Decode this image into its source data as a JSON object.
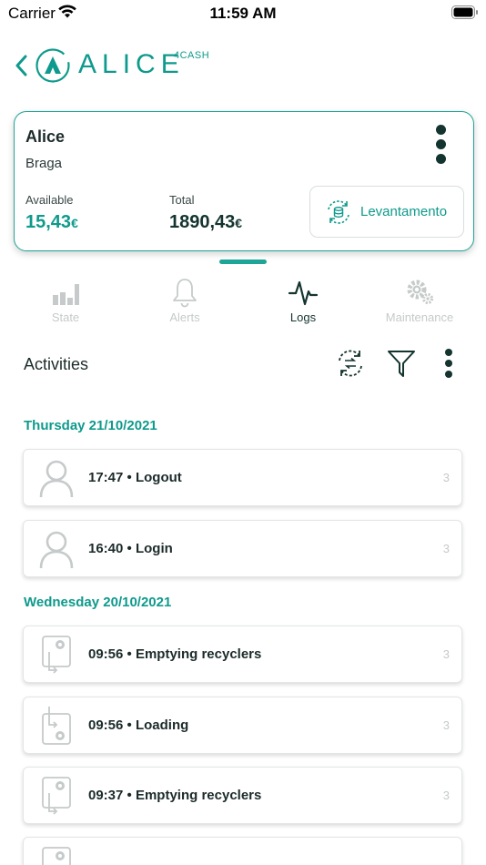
{
  "status_bar": {
    "carrier": "Carrier",
    "time": "11:59 AM"
  },
  "header": {
    "logo_text": "ALICE",
    "logo_superscript": "4CASH",
    "back_icon": "chevron-left-icon"
  },
  "machine": {
    "name": "Alice",
    "location": "Braga",
    "available_label": "Available",
    "available_value": "15,43",
    "total_label": "Total",
    "total_value": "1890,43",
    "currency": "€",
    "withdraw_button": "Levantamento"
  },
  "tabs": [
    {
      "label": "State",
      "icon": "bar-chart-icon",
      "active": false
    },
    {
      "label": "Alerts",
      "icon": "bell-icon",
      "active": false
    },
    {
      "label": "Logs",
      "icon": "pulse-icon",
      "active": true
    },
    {
      "label": "Maintenance",
      "icon": "gears-icon",
      "active": false
    }
  ],
  "activities": {
    "title": "Activities",
    "groups": [
      {
        "date": "Thursday 21/10/2021",
        "items": [
          {
            "text": "17:47 • Logout",
            "count": "3",
            "icon": "user-icon"
          },
          {
            "text": "16:40 • Login",
            "count": "3",
            "icon": "user-icon"
          }
        ]
      },
      {
        "date": "Wednesday 20/10/2021",
        "items": [
          {
            "text": "09:56 • Emptying recyclers",
            "count": "3",
            "icon": "recycler-out-icon"
          },
          {
            "text": "09:56 • Loading",
            "count": "3",
            "icon": "recycler-in-icon"
          },
          {
            "text": "09:37 • Emptying recyclers",
            "count": "3",
            "icon": "recycler-out-icon"
          }
        ]
      }
    ]
  },
  "colors": {
    "accent": "#0e9a8c",
    "dark": "#14342f",
    "inactive": "#c6caca"
  }
}
